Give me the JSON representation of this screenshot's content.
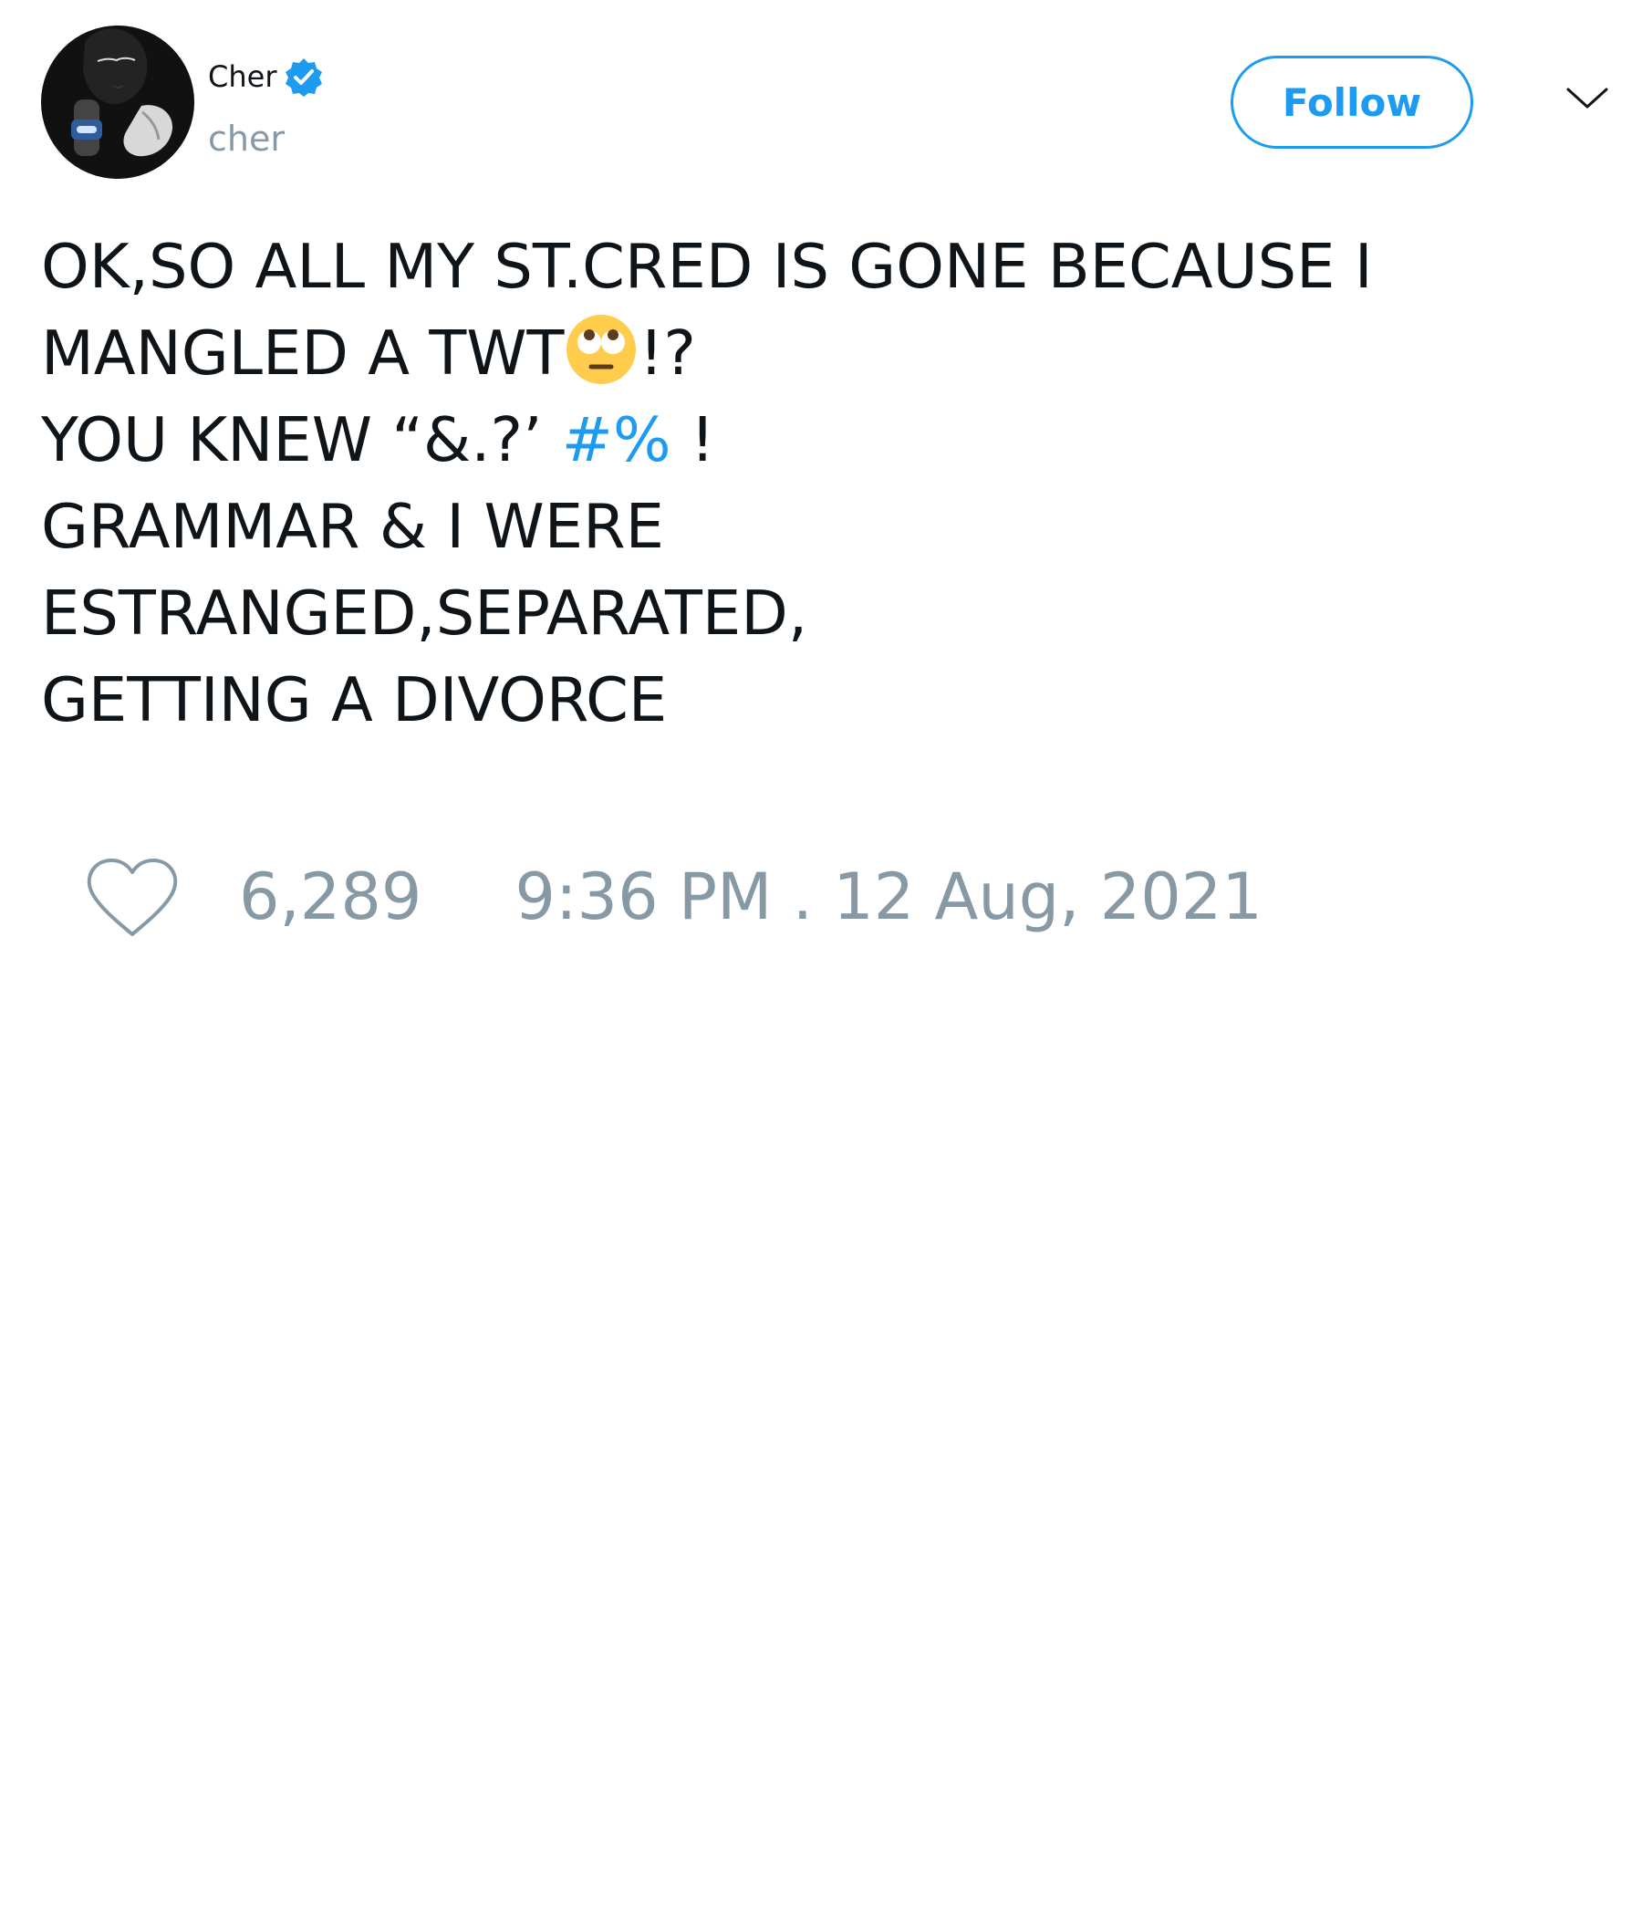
{
  "author": {
    "display_name": "Cher",
    "handle": "cher",
    "verified": true,
    "avatar_icon": "profile-photo"
  },
  "actions": {
    "follow_label": "Follow",
    "more_icon": "chevron-down-icon"
  },
  "tweet": {
    "line1": "OK,SO ALL MY ST.CRED IS GONE BECAUSE I",
    "line2_text": "MANGLED A TWT",
    "line2_emoji": "face-with-rolling-eyes",
    "line2_suffix": "!?",
    "line3_text": "YOU KNEW “&.?’ ",
    "line3_hashtag": "#%",
    "line3_suffix": " !",
    "line4": "GRAMMAR & I WERE",
    "line5": "ESTRANGED,SEPARATED,",
    "line6": "GETTING A DIVORCE"
  },
  "footer": {
    "like_count": "6,289",
    "timestamp": "9:36 PM . 12 Aug, 2021"
  },
  "colors": {
    "accent": "#1d9bf0",
    "muted": "#8899a6",
    "text": "#0f1419"
  }
}
